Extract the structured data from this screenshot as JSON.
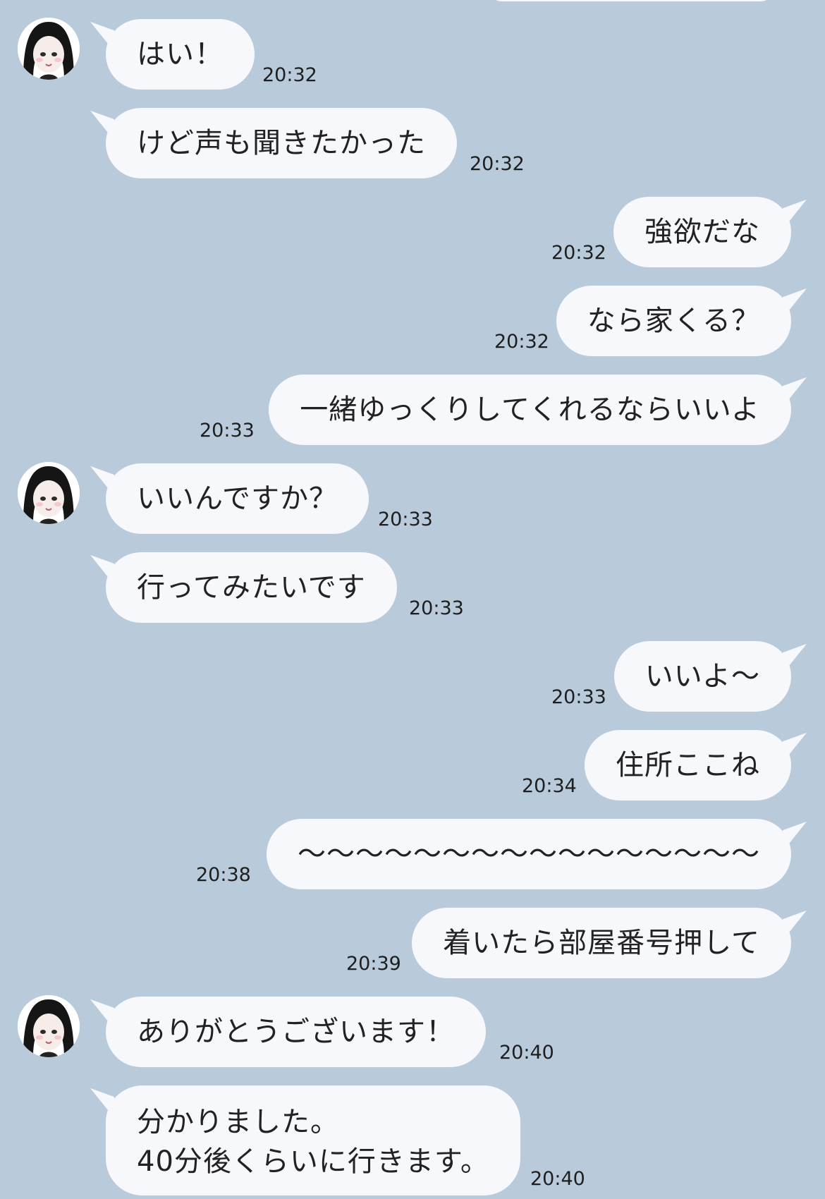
{
  "messages": [
    {
      "side": "in",
      "avatar": true,
      "lines": [
        "はい！"
      ],
      "time": "20:32"
    },
    {
      "side": "in",
      "avatar": false,
      "lines": [
        "けど声も聞きたかった"
      ],
      "time": "20:32"
    },
    {
      "side": "out",
      "lines": [
        "強欲だな"
      ],
      "time": "20:32"
    },
    {
      "side": "out",
      "lines": [
        "なら家くる？"
      ],
      "time": "20:32"
    },
    {
      "side": "out",
      "lines": [
        "一緒ゆっくりしてくれるならいいよ"
      ],
      "time": "20:33"
    },
    {
      "side": "in",
      "avatar": true,
      "lines": [
        "いいんですか？"
      ],
      "time": "20:33"
    },
    {
      "side": "in",
      "avatar": false,
      "lines": [
        "行ってみたいです"
      ],
      "time": "20:33"
    },
    {
      "side": "out",
      "lines": [
        "いいよ〜"
      ],
      "time": "20:33"
    },
    {
      "side": "out",
      "lines": [
        "住所ここね"
      ],
      "time": "20:34"
    },
    {
      "side": "out",
      "lines": [
        "〜〜〜〜〜〜〜〜〜〜〜〜〜〜〜〜"
      ],
      "time": "20:38"
    },
    {
      "side": "out",
      "lines": [
        "着いたら部屋番号押して"
      ],
      "time": "20:39"
    },
    {
      "side": "in",
      "avatar": true,
      "lines": [
        "ありがとうございます！"
      ],
      "time": "20:40"
    },
    {
      "side": "in",
      "avatar": false,
      "lines": [
        "分かりました。",
        "40分後くらいに行きます。"
      ],
      "time": "20:40"
    }
  ],
  "colors": {
    "background": "#b9cadb",
    "bubble": "#f7f8fb",
    "text": "#222222"
  },
  "icons": {
    "avatar": "anime-girl-avatar-icon"
  }
}
